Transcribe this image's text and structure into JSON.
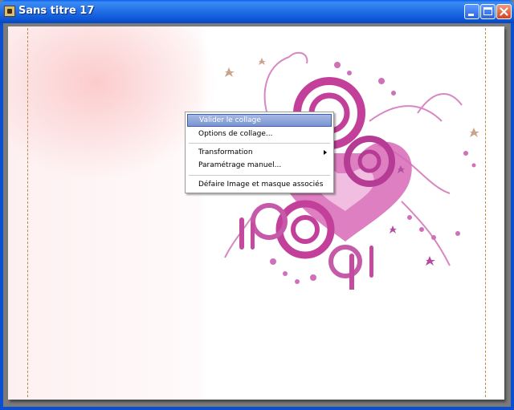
{
  "window": {
    "title": "Sans titre 17",
    "icon": "app-document-icon",
    "controls": [
      "minimize-icon",
      "maximize-icon",
      "close-icon"
    ]
  },
  "context_menu": {
    "items": [
      {
        "label": "Valider le collage",
        "highlighted": true
      },
      {
        "label": "Options de collage..."
      },
      {
        "label": "Transformation",
        "submenu": true
      },
      {
        "label": "Paramétrage manuel..."
      },
      {
        "label": "Défaire Image et masque associés"
      }
    ]
  },
  "colors": {
    "titlebar": "#2470e6",
    "workspace": "#7b7b7b",
    "highlight": "#8ea4d9",
    "art_pink": "#d65aa8",
    "art_magenta": "#b43c96",
    "art_tan": "#c9a48a"
  }
}
